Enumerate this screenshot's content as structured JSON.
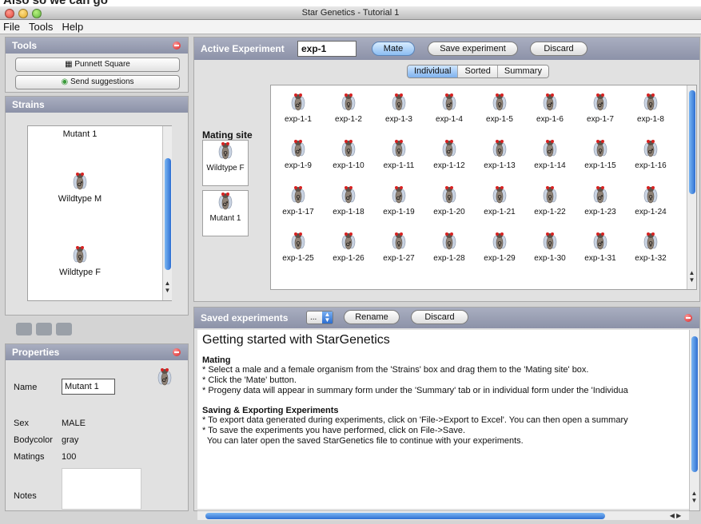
{
  "page_caption": "Also so we can go",
  "window": {
    "title": "Star Genetics - Tutorial 1"
  },
  "menu": [
    "File",
    "Tools",
    "Help"
  ],
  "tools_panel": {
    "title": "Tools",
    "punnett_label": "Punnett Square",
    "suggestions_label": "Send suggestions"
  },
  "strains_panel": {
    "title": "Strains",
    "items": [
      {
        "label": "Mutant 1",
        "sex_symbol": "♂"
      },
      {
        "label": "Wildtype M",
        "sex_symbol": "♂"
      },
      {
        "label": "Wildtype F",
        "sex_symbol": "♀"
      }
    ],
    "scroll_fraction": 0.5
  },
  "properties_panel": {
    "title": "Properties",
    "name_label": "Name",
    "name_value": "Mutant 1",
    "sex_label": "Sex",
    "sex_value": "MALE",
    "bodycolor_label": "Bodycolor",
    "bodycolor_value": "gray",
    "matings_label": "Matings",
    "matings_value": "100",
    "notes_label": "Notes"
  },
  "active_experiment": {
    "title": "Active Experiment",
    "name_value": "exp-1",
    "mate_label": "Mate",
    "save_label": "Save experiment",
    "discard_label": "Discard",
    "tabs": [
      "Individual",
      "Sorted",
      "Summary"
    ],
    "active_tab": 0,
    "mating_site_title": "Mating site",
    "mating_site": [
      {
        "label": "Wildtype F",
        "sex_symbol": "♀"
      },
      {
        "label": "Mutant 1",
        "sex_symbol": "♂"
      }
    ],
    "progeny": [
      {
        "label": "exp-1-1",
        "sex_symbol": "♂"
      },
      {
        "label": "exp-1-2",
        "sex_symbol": "♀"
      },
      {
        "label": "exp-1-3",
        "sex_symbol": "♀"
      },
      {
        "label": "exp-1-4",
        "sex_symbol": "♂"
      },
      {
        "label": "exp-1-5",
        "sex_symbol": "♀"
      },
      {
        "label": "exp-1-6",
        "sex_symbol": "♂"
      },
      {
        "label": "exp-1-7",
        "sex_symbol": "♂"
      },
      {
        "label": "exp-1-8",
        "sex_symbol": "♀"
      },
      {
        "label": "exp-1-9",
        "sex_symbol": "♂"
      },
      {
        "label": "exp-1-10",
        "sex_symbol": "♀"
      },
      {
        "label": "exp-1-11",
        "sex_symbol": "♀"
      },
      {
        "label": "exp-1-12",
        "sex_symbol": "♂"
      },
      {
        "label": "exp-1-13",
        "sex_symbol": "♀"
      },
      {
        "label": "exp-1-14",
        "sex_symbol": "♂"
      },
      {
        "label": "exp-1-15",
        "sex_symbol": "♀"
      },
      {
        "label": "exp-1-16",
        "sex_symbol": "♂"
      },
      {
        "label": "exp-1-17",
        "sex_symbol": "♀"
      },
      {
        "label": "exp-1-18",
        "sex_symbol": "♂"
      },
      {
        "label": "exp-1-19",
        "sex_symbol": "♂"
      },
      {
        "label": "exp-1-20",
        "sex_symbol": "♀"
      },
      {
        "label": "exp-1-21",
        "sex_symbol": "♀"
      },
      {
        "label": "exp-1-22",
        "sex_symbol": "♀"
      },
      {
        "label": "exp-1-23",
        "sex_symbol": "♂"
      },
      {
        "label": "exp-1-24",
        "sex_symbol": "♀"
      },
      {
        "label": "exp-1-25",
        "sex_symbol": "♀"
      },
      {
        "label": "exp-1-26",
        "sex_symbol": "♂"
      },
      {
        "label": "exp-1-27",
        "sex_symbol": "♀"
      },
      {
        "label": "exp-1-28",
        "sex_symbol": "♀"
      },
      {
        "label": "exp-1-29",
        "sex_symbol": "♀"
      },
      {
        "label": "exp-1-30",
        "sex_symbol": "♀"
      },
      {
        "label": "exp-1-31",
        "sex_symbol": "♂"
      },
      {
        "label": "exp-1-32",
        "sex_symbol": "♀"
      }
    ]
  },
  "saved_experiments": {
    "title": "Saved experiments",
    "select_value": "...",
    "rename_label": "Rename",
    "discard_label": "Discard"
  },
  "doc": {
    "heading": "Getting started with StarGenetics",
    "mating_heading": "Mating",
    "mating_lines": [
      "* Select a male and a female organism from the 'Strains' box and drag them to the 'Mating site' box.",
      "* Click the 'Mate' button.",
      "* Progeny data will appear in summary form under the 'Summary' tab or in individual form under the 'Individua"
    ],
    "saving_heading": "Saving & Exporting Experiments",
    "saving_lines": [
      "* To export data generated during experiments, click on 'File->Export to Excel'. You can then open a summary",
      "* To save the experiments you have performed, click on File->Save.",
      "  You can later open the saved StarGenetics file to continue with your experiments."
    ]
  }
}
